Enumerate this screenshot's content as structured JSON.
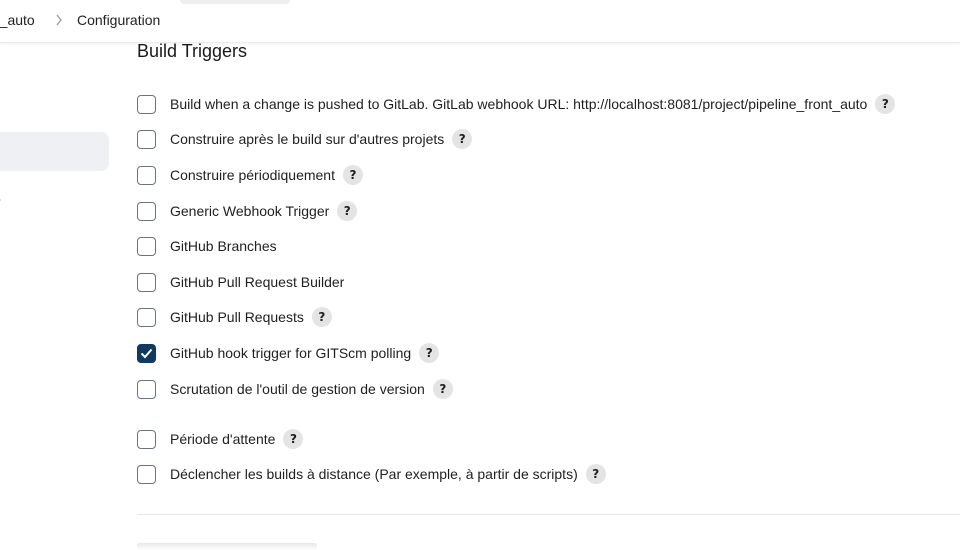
{
  "breadcrumb": {
    "parent": "nt_auto",
    "current": "Configuration"
  },
  "section": {
    "title": "Build Triggers"
  },
  "triggers": [
    {
      "label": "Build when a change is pushed to GitLab. GitLab webhook URL: http://localhost:8081/project/pipeline_front_auto",
      "checked": false,
      "help": "?"
    },
    {
      "label": "Construire après le build sur d'autres projets",
      "checked": false,
      "help": "?"
    },
    {
      "label": "Construire périodiquement",
      "checked": false,
      "help": "?"
    },
    {
      "label": "Generic Webhook Trigger",
      "checked": false,
      "help": "?"
    },
    {
      "label": "GitHub Branches",
      "checked": false
    },
    {
      "label": "GitHub Pull Request Builder",
      "checked": false
    },
    {
      "label": "GitHub Pull Requests",
      "checked": false,
      "help": "?"
    },
    {
      "label": "GitHub hook trigger for GITScm polling",
      "checked": true,
      "help": "?"
    },
    {
      "label": "Scrutation de l'outil de gestion de version",
      "checked": false,
      "help": "?"
    }
  ],
  "extra_options": [
    {
      "label": "Période d'attente",
      "checked": false,
      "help": "?"
    },
    {
      "label": "Déclencher les builds à distance (Par exemple, à partir de scripts)",
      "checked": false,
      "help": "?"
    }
  ],
  "colors": {
    "checkbox_checked": "#123a5e",
    "sidebar_active": "#eef0f3",
    "help_bg": "#e4e4e4"
  }
}
